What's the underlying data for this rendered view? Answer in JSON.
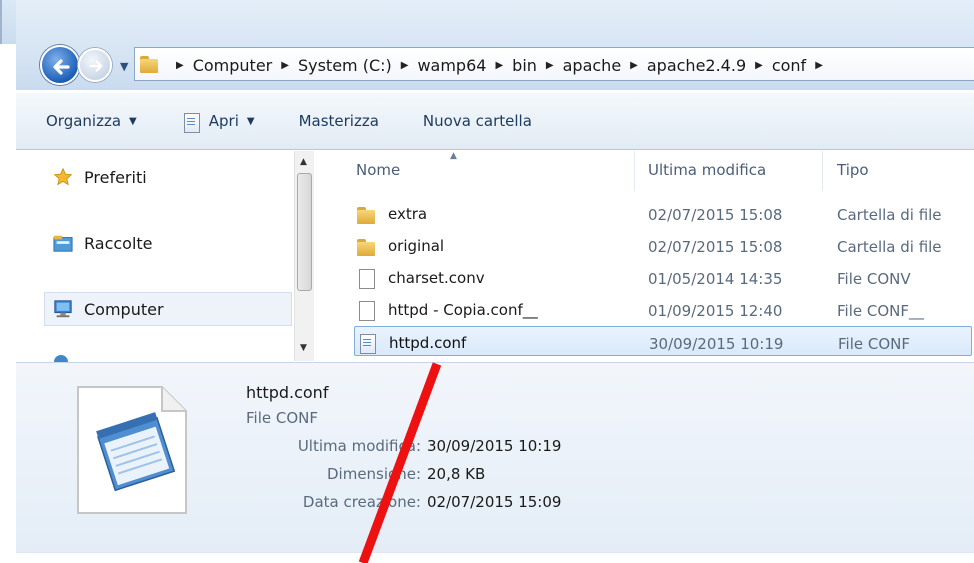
{
  "address_bar": {
    "breadcrumbs": [
      "Computer",
      "System (C:)",
      "wamp64",
      "bin",
      "apache",
      "apache2.4.9",
      "conf"
    ]
  },
  "toolbar": {
    "organize_label": "Organizza",
    "open_label": "Apri",
    "burn_label": "Masterizza",
    "new_folder_label": "Nuova cartella"
  },
  "nav_pane": {
    "favorites_label": "Preferiti",
    "libraries_label": "Raccolte",
    "computer_label": "Computer"
  },
  "file_list": {
    "columns": {
      "name": "Nome",
      "modified": "Ultima modifica",
      "type": "Tipo"
    },
    "rows": [
      {
        "name": "extra",
        "modified": "02/07/2015 15:08",
        "type": "Cartella di file",
        "icon": "folder-icon"
      },
      {
        "name": "original",
        "modified": "02/07/2015 15:08",
        "type": "Cartella di file",
        "icon": "folder-icon"
      },
      {
        "name": "charset.conv",
        "modified": "01/05/2014 14:35",
        "type": "File CONV",
        "icon": "file-icon"
      },
      {
        "name": "httpd - Copia.conf__",
        "modified": "01/09/2015 12:40",
        "type": "File CONF__",
        "icon": "file-icon"
      },
      {
        "name": "httpd.conf",
        "modified": "30/09/2015 10:19",
        "type": "File CONF",
        "icon": "notepad-file-icon",
        "selected": true
      }
    ]
  },
  "details": {
    "file_name": "httpd.conf",
    "file_type": "File CONF",
    "modified_label": "Ultima modifica:",
    "modified_value": "30/09/2015 10:19",
    "size_label": "Dimensione:",
    "size_value": "20,8 KB",
    "created_label": "Data creazione:",
    "created_value": "02/07/2015 15:09"
  },
  "colors": {
    "annotation_red": "#ee1111",
    "selection_border": "#84acdd",
    "selection_fill": "#d9e9fb"
  }
}
